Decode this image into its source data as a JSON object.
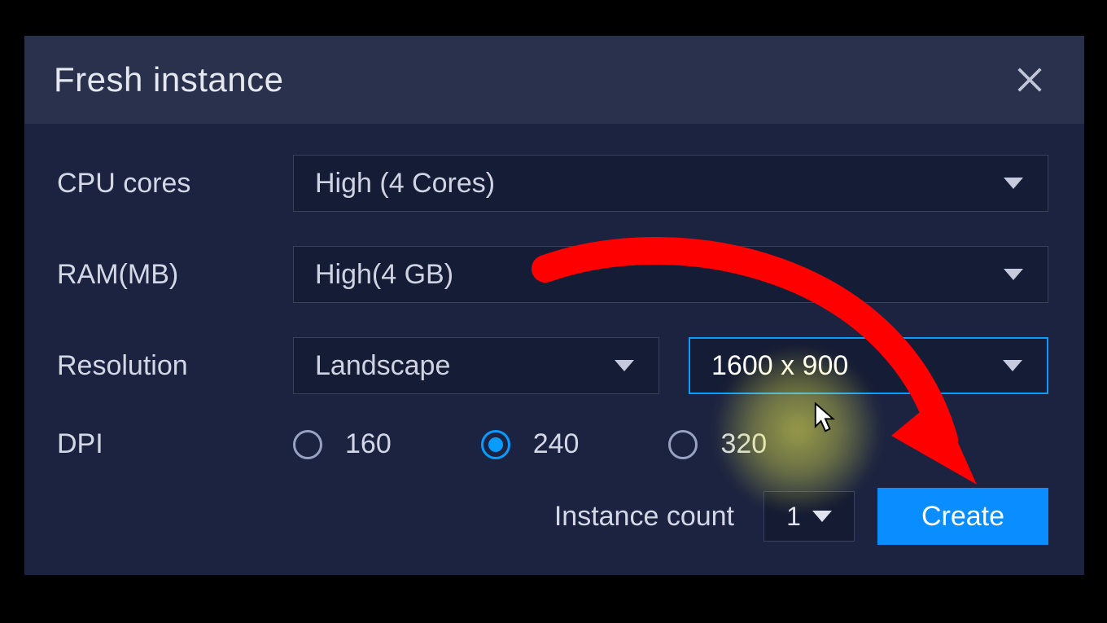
{
  "dialog": {
    "title": "Fresh instance",
    "close_icon": "close-icon"
  },
  "fields": {
    "cpu": {
      "label": "CPU cores",
      "value": "High (4 Cores)"
    },
    "ram": {
      "label": "RAM(MB)",
      "value": "High(4 GB)"
    },
    "resolution": {
      "label": "Resolution",
      "orientation": "Landscape",
      "size": "1600 x 900"
    },
    "dpi": {
      "label": "DPI",
      "options": [
        "160",
        "240",
        "320"
      ],
      "selected": "240"
    }
  },
  "footer": {
    "instance_count_label": "Instance count",
    "instance_count_value": "1",
    "create_label": "Create"
  },
  "annotation": {
    "arrow_color": "#ff0000",
    "highlight_color": "#ffff55"
  }
}
